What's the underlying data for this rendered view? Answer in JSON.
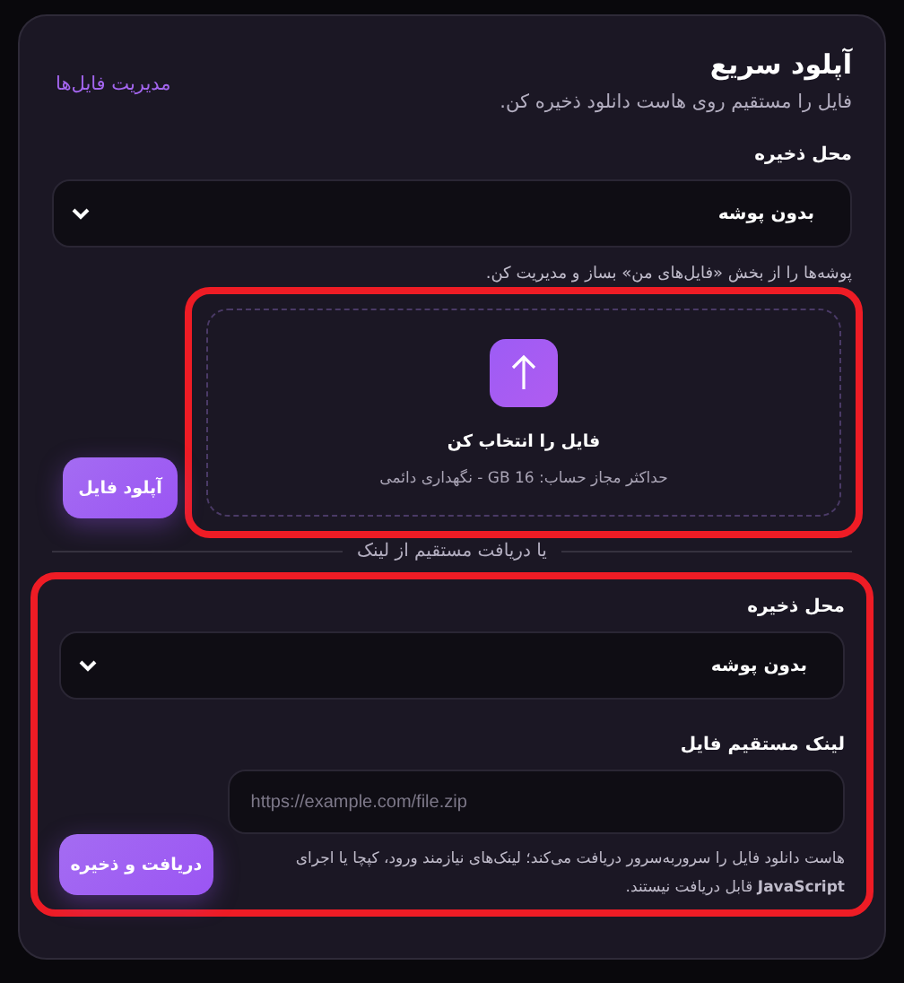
{
  "header": {
    "title": "آپلود سریع",
    "subtitle": "فایل را مستقیم روی هاست دانلود ذخیره کن.",
    "manage_link": "مدیریت فایل‌ها"
  },
  "upload": {
    "folder_label": "محل ذخیره",
    "folder_value": "بدون پوشه",
    "folder_hint": "پوشه‌ها را از بخش «فایل‌های من» بساز و مدیریت کن.",
    "dropzone_title": "فایل را انتخاب کن",
    "dropzone_hint": "حداکثر مجاز حساب: GB 16 - نگهداری دائمی",
    "button": "آپلود فایل"
  },
  "divider": "یا دریافت مستقیم از لینک",
  "link": {
    "folder_label": "محل ذخیره",
    "folder_value": "بدون پوشه",
    "url_label": "لینک مستقیم فایل",
    "url_placeholder": "https://example.com/file.zip",
    "note": "هاست دانلود فایل را سروربه‌سرور دریافت می‌کند؛ لینک‌های نیازمند ورود، کپچا یا اجرای **JavaScript** قابل دریافت نیستند.",
    "button": "دریافت و ذخیره"
  }
}
